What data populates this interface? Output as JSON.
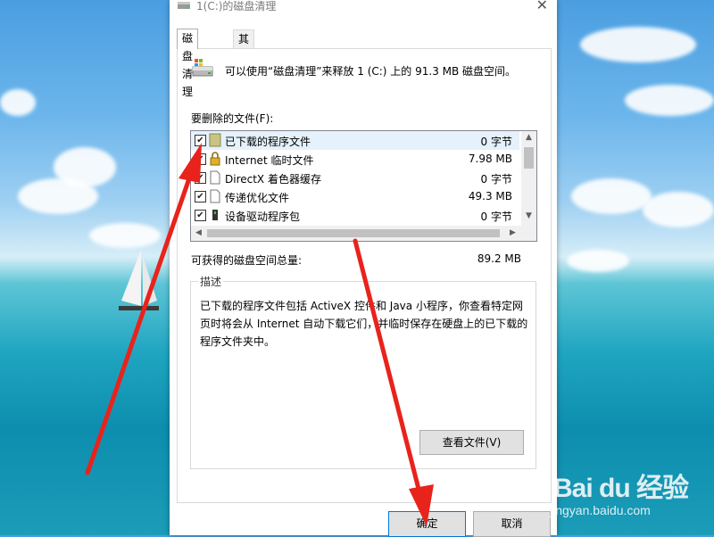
{
  "window": {
    "title": "1(C:)的磁盘清理",
    "close_glyph": "✕"
  },
  "tabs": [
    {
      "label": "磁盘清理",
      "active": true
    },
    {
      "label": "其他选项",
      "active": false
    }
  ],
  "intro_text": "可以使用“磁盘清理”来释放 1 (C:) 上的 91.3 MB 磁盘空间。",
  "files_label": "要删除的文件(F):",
  "files": [
    {
      "checked": true,
      "icon": "folder-icon",
      "name": "已下载的程序文件",
      "size": "0 字节",
      "selected": true
    },
    {
      "checked": true,
      "icon": "lock-icon",
      "name": "Internet 临时文件",
      "size": "7.98 MB",
      "selected": false
    },
    {
      "checked": true,
      "icon": "file-icon",
      "name": "DirectX 着色器缓存",
      "size": "0 字节",
      "selected": false
    },
    {
      "checked": true,
      "icon": "file-icon",
      "name": "传递优化文件",
      "size": "49.3 MB",
      "selected": false
    },
    {
      "checked": true,
      "icon": "device-icon",
      "name": "设备驱动程序包",
      "size": "0 字节",
      "selected": false
    }
  ],
  "total": {
    "label": "可获得的磁盘空间总量:",
    "value": "89.2 MB"
  },
  "description": {
    "title": "描述",
    "text": "已下载的程序文件包括 ActiveX 控件和 Java 小程序，你查看特定网页时将会从 Internet 自动下载它们，并临时保存在硬盘上的已下载的程序文件夹中。",
    "view_files_label": "查看文件(V)"
  },
  "buttons": {
    "ok": "确定",
    "cancel": "取消"
  },
  "watermark": {
    "logo": "Bai du 经验",
    "url": "jingyan.baidu.com"
  },
  "colors": {
    "arrow": "#e8231c",
    "focus_border": "#0078d7",
    "selected_row": "#e5f1fb"
  }
}
